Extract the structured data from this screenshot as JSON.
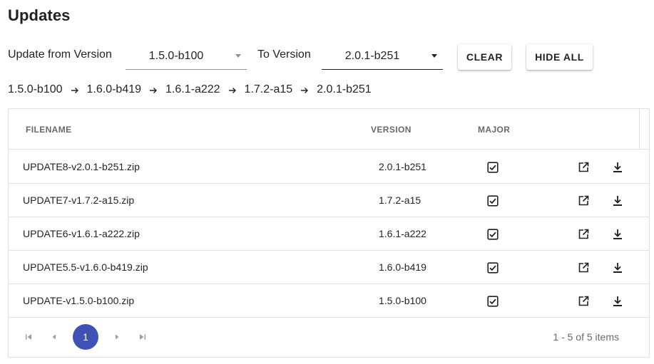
{
  "page": {
    "title": "Updates"
  },
  "filters": {
    "from_label": "Update from Version",
    "from_value": "1.5.0-b100",
    "to_label": "To Version",
    "to_value": "2.0.1-b251",
    "clear_label": "CLEAR",
    "hide_all_label": "HIDE ALL"
  },
  "upgrade_path": [
    "1.5.0-b100",
    "1.6.0-b419",
    "1.6.1-a222",
    "1.7.2-a15",
    "2.0.1-b251"
  ],
  "table": {
    "columns": {
      "filename": "FILENAME",
      "version": "VERSION",
      "major": "MAJOR"
    },
    "rows": [
      {
        "filename": "UPDATE8-v2.0.1-b251.zip",
        "version": "2.0.1-b251",
        "major": true
      },
      {
        "filename": "UPDATE7-v1.7.2-a15.zip",
        "version": "1.7.2-a15",
        "major": true
      },
      {
        "filename": "UPDATE6-v1.6.1-a222.zip",
        "version": "1.6.1-a222",
        "major": true
      },
      {
        "filename": "UPDATE5.5-v1.6.0-b419.zip",
        "version": "1.6.0-b419",
        "major": true
      },
      {
        "filename": "UPDATE-v1.5.0-b100.zip",
        "version": "1.5.0-b100",
        "major": true
      }
    ],
    "row_icons": [
      "open-in-new-icon",
      "download-icon"
    ]
  },
  "pager": {
    "current_page": "1",
    "info": "1 - 5 of 5 items",
    "icons": [
      "first-page-icon",
      "prev-page-icon",
      "next-page-icon",
      "last-page-icon"
    ]
  },
  "colors": {
    "accent": "#3f51b5",
    "divider": "#e0e0e0"
  }
}
